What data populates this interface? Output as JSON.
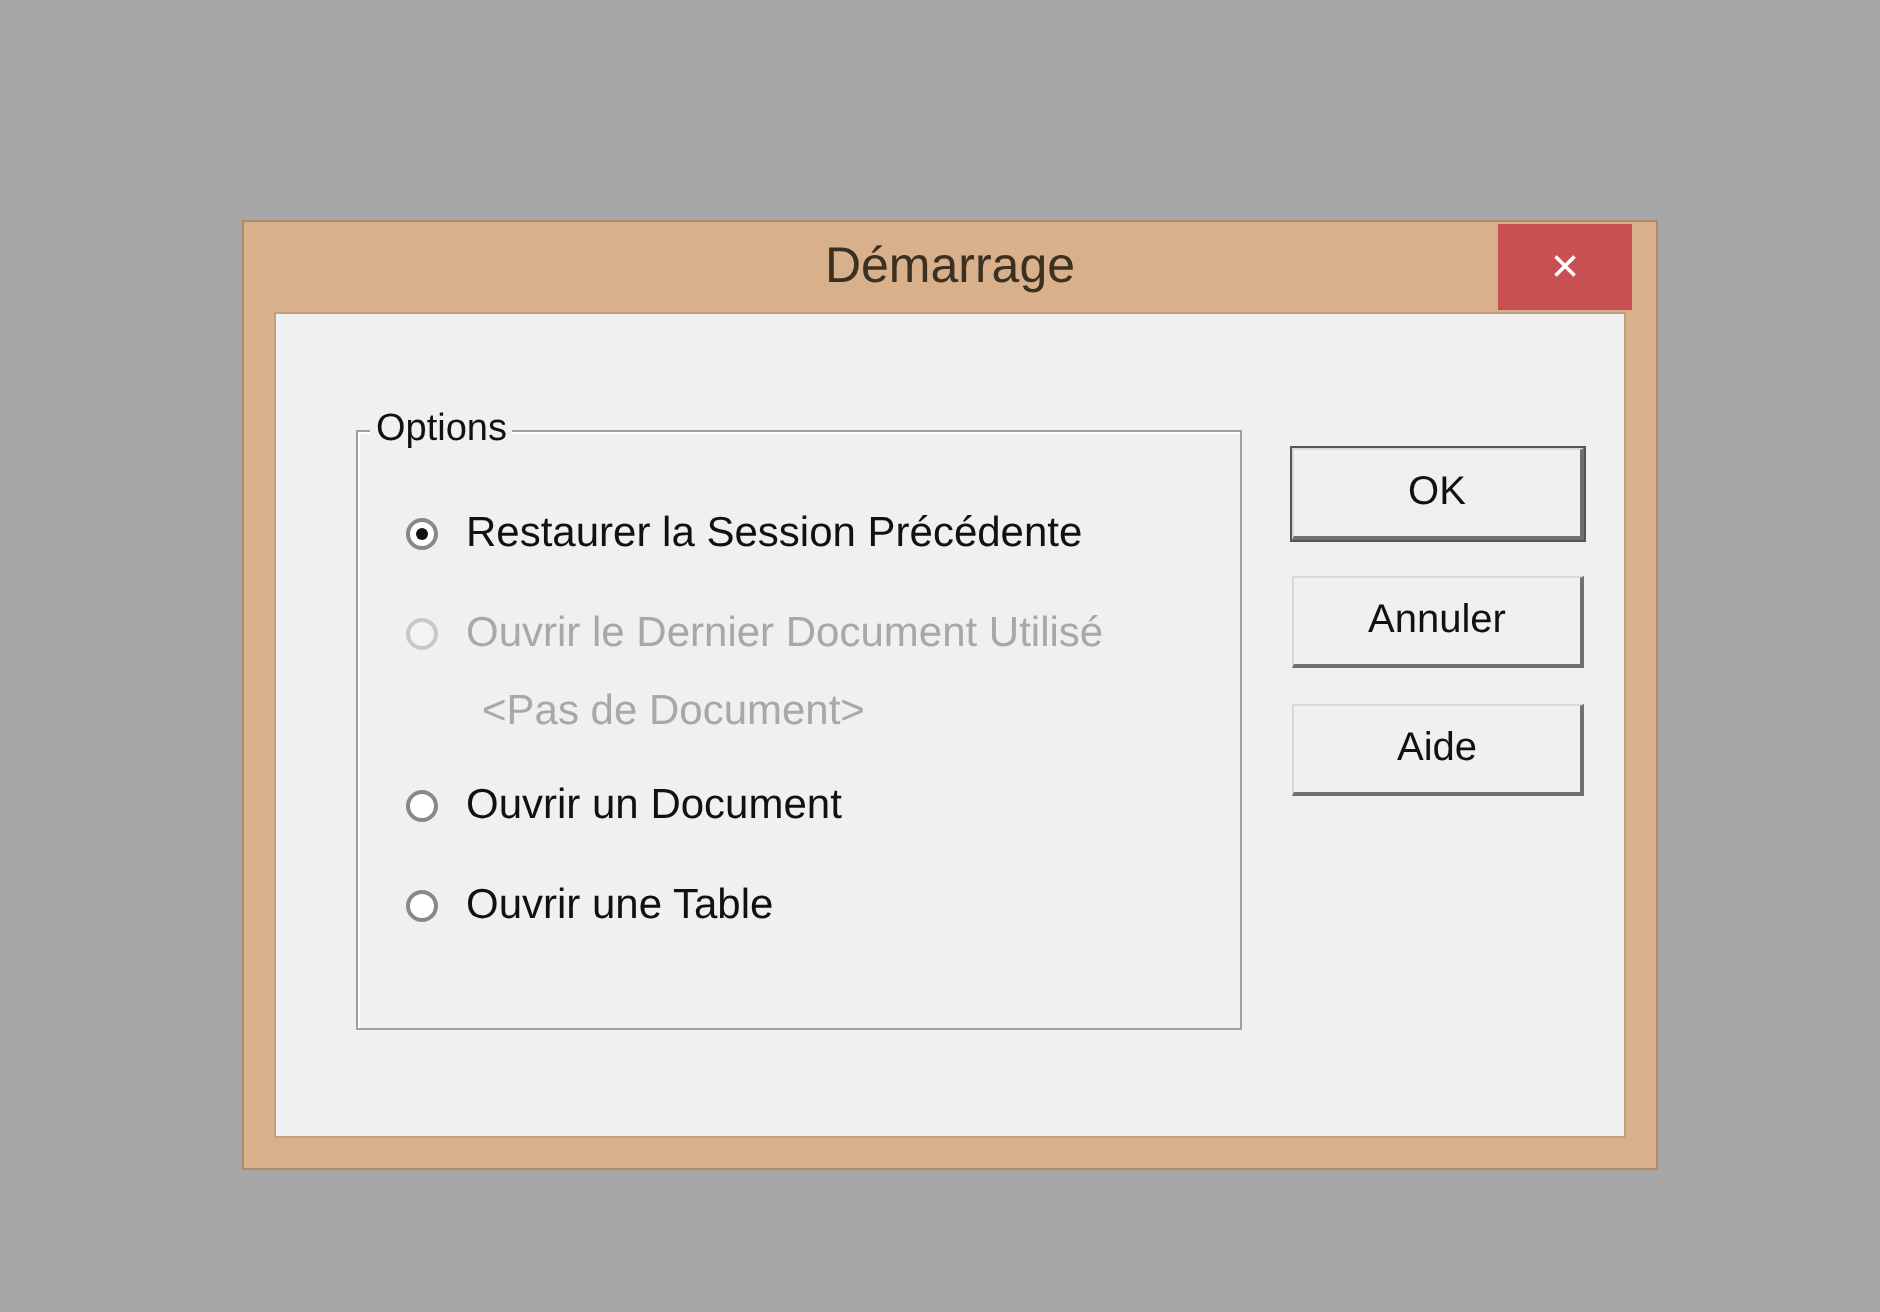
{
  "window": {
    "title": "Démarrage",
    "close": "×"
  },
  "group": {
    "title": "Options",
    "options": [
      {
        "label": "Restaurer la Session Précédente",
        "selected": true,
        "disabled": false
      },
      {
        "label": "Ouvrir le Dernier Document Utilisé",
        "detail": "<Pas de Document>",
        "selected": false,
        "disabled": true
      },
      {
        "label": "Ouvrir un Document",
        "selected": false,
        "disabled": false
      },
      {
        "label": "Ouvrir une Table",
        "selected": false,
        "disabled": false
      }
    ]
  },
  "buttons": [
    {
      "label": "OK",
      "default": true
    },
    {
      "label": "Annuler",
      "default": false
    },
    {
      "label": "Aide",
      "default": false
    }
  ]
}
